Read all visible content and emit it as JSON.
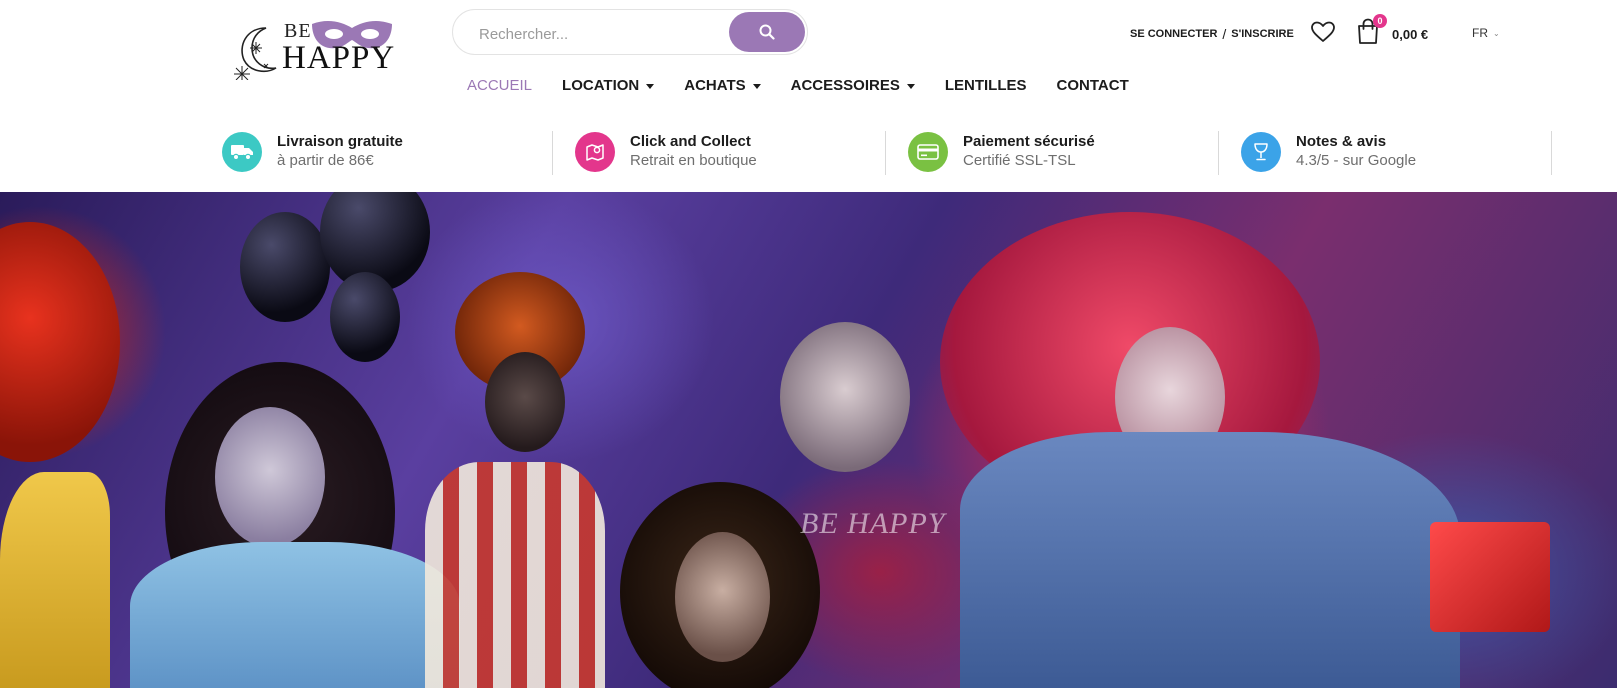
{
  "logo": {
    "line1": "BE",
    "line2": "HAPPY",
    "mask_color": "#9b78b5"
  },
  "search": {
    "placeholder": "Rechercher...",
    "button_icon": "search-icon"
  },
  "header": {
    "login": "SE CONNECTER",
    "separator": "/",
    "register": "S'INSCRIRE",
    "wishlist_icon": "heart-icon",
    "cart_icon": "shopping-bag-icon",
    "cart_count": "0",
    "cart_total": "0,00 €",
    "language": "FR"
  },
  "nav": {
    "items": [
      {
        "label": "ACCUEIL",
        "active": true,
        "dropdown": false
      },
      {
        "label": "LOCATION",
        "active": false,
        "dropdown": true
      },
      {
        "label": "ACHATS",
        "active": false,
        "dropdown": true
      },
      {
        "label": "ACCESSOIRES",
        "active": false,
        "dropdown": true
      },
      {
        "label": "LENTILLES",
        "active": false,
        "dropdown": false
      },
      {
        "label": "CONTACT",
        "active": false,
        "dropdown": false
      }
    ]
  },
  "features": [
    {
      "title": "Livraison gratuite",
      "subtitle": "à partir de 86€",
      "icon": "truck-icon",
      "color": "#3cc9c4"
    },
    {
      "title": "Click and Collect",
      "subtitle": "Retrait en boutique",
      "icon": "map-pin-icon",
      "color": "#e3368c"
    },
    {
      "title": "Paiement sécurisé",
      "subtitle": "Certifié SSL-TSL",
      "icon": "credit-card-icon",
      "color": "#7ac142"
    },
    {
      "title": "Notes & avis",
      "subtitle": "4.3/5 - sur Google",
      "icon": "trophy-icon",
      "color": "#3ba3e8"
    }
  ],
  "hero": {
    "watermark": "BE HAPPY"
  },
  "colors": {
    "accent": "#9b78b5",
    "badge": "#e3368c",
    "text": "#1c1c1c"
  }
}
